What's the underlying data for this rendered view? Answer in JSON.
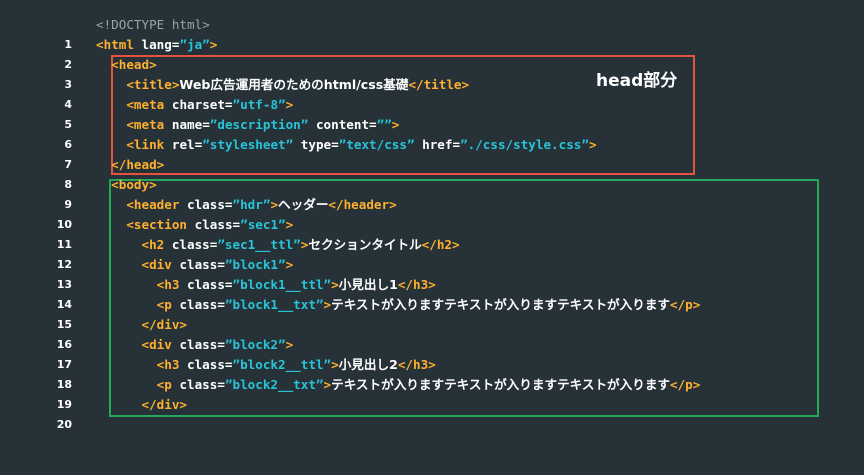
{
  "head_label": "head部分",
  "code": {
    "doctype": "<!DOCTYPE html>",
    "html_open": "<html",
    "lang_attr": "lang=",
    "lang_val": "”ja”",
    "gt": ">",
    "head_open": "<head>",
    "title_open": "<title>",
    "title_text": "Web広告運用者のためのhtml/css基礎",
    "title_close": "</title>",
    "meta_open": "<meta",
    "charset_attr": "charset=",
    "charset_val": "”utf-8”",
    "name_attr": "name=",
    "name_val": "”description”",
    "content_attr": "content=",
    "content_val": "””",
    "link_open": "<link",
    "rel_attr": "rel=",
    "rel_val": "”stylesheet”",
    "type_attr": "type=",
    "type_val": "”text/css”",
    "href_attr": "href=",
    "href_val": "”./css/style.css”",
    "head_close": "</head>",
    "body_open": "<body>",
    "header_open": "<header",
    "class_attr": "class=",
    "hdr_val": "”hdr”",
    "header_text": "ヘッダー",
    "header_close": "</header>",
    "section_open": "<section",
    "sec1_val": "”sec1”",
    "h2_open": "<h2",
    "sec1_ttl_val": "”sec1__ttl”",
    "h2_text": "セクションタイトル",
    "h2_close": "</h2>",
    "div_open": "<div",
    "block1_val": "”block1”",
    "h3_open": "<h3",
    "block1_ttl_val": "”block1__ttl”",
    "h3_1_text": "小見出し1",
    "h3_close": "</h3>",
    "p_open": "<p",
    "block1_txt_val": "”block1__txt”",
    "p_text": "テキストが入りますテキストが入りますテキストが入ります",
    "p_close": "</p>",
    "div_close": "</div>",
    "block2_val": "”block2”",
    "block2_ttl_val": "”block2__ttl”",
    "h3_2_text": "小見出し2",
    "block2_txt_val": "”block2__txt”"
  },
  "colors": {
    "background": "#263238",
    "tag": "#ffb02e",
    "attribute": "#ffffff",
    "string": "#29c4d8",
    "head_box": "#e5533f",
    "body_box": "#26a85b"
  }
}
